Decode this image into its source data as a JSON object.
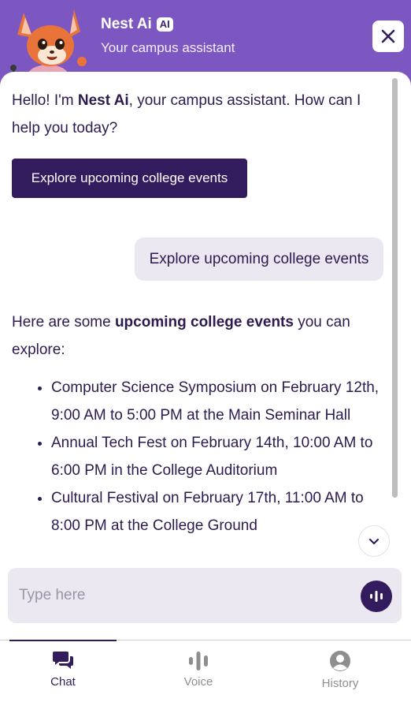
{
  "header": {
    "title": "Nest Ai",
    "badge": "AI",
    "subtitle": "Your campus assistant",
    "colors": {
      "background": "#7c57c2"
    }
  },
  "chat": {
    "greeting_prefix": "Hello! I'm ",
    "greeting_name": "Nest Ai",
    "greeting_suffix": ", your campus assistant. How can I help you today?",
    "suggestion": "Explore upcoming college events",
    "user_message": "Explore upcoming college events",
    "reply_prefix": "Here are some ",
    "reply_bold": "upcoming college events",
    "reply_suffix": " you can explore:",
    "events": [
      "Computer Science Symposium on February 12th, 9:00 AM to 5:00 PM at the Main Seminar Hall",
      "Annual Tech Fest on February 14th, 10:00 AM to 6:00 PM in the College Auditorium",
      "Cultural Festival on February 17th, 11:00 AM to 8:00 PM at the College Ground"
    ]
  },
  "input": {
    "placeholder": "Type here"
  },
  "nav": {
    "items": [
      {
        "label": "Chat",
        "icon": "chat-bubbles-icon",
        "active": true
      },
      {
        "label": "Voice",
        "icon": "voice-bars-icon",
        "active": false
      },
      {
        "label": "History",
        "icon": "user-circle-icon",
        "active": false
      }
    ]
  },
  "colors": {
    "accent": "#321c5e",
    "bubble": "#ebe8f1"
  }
}
